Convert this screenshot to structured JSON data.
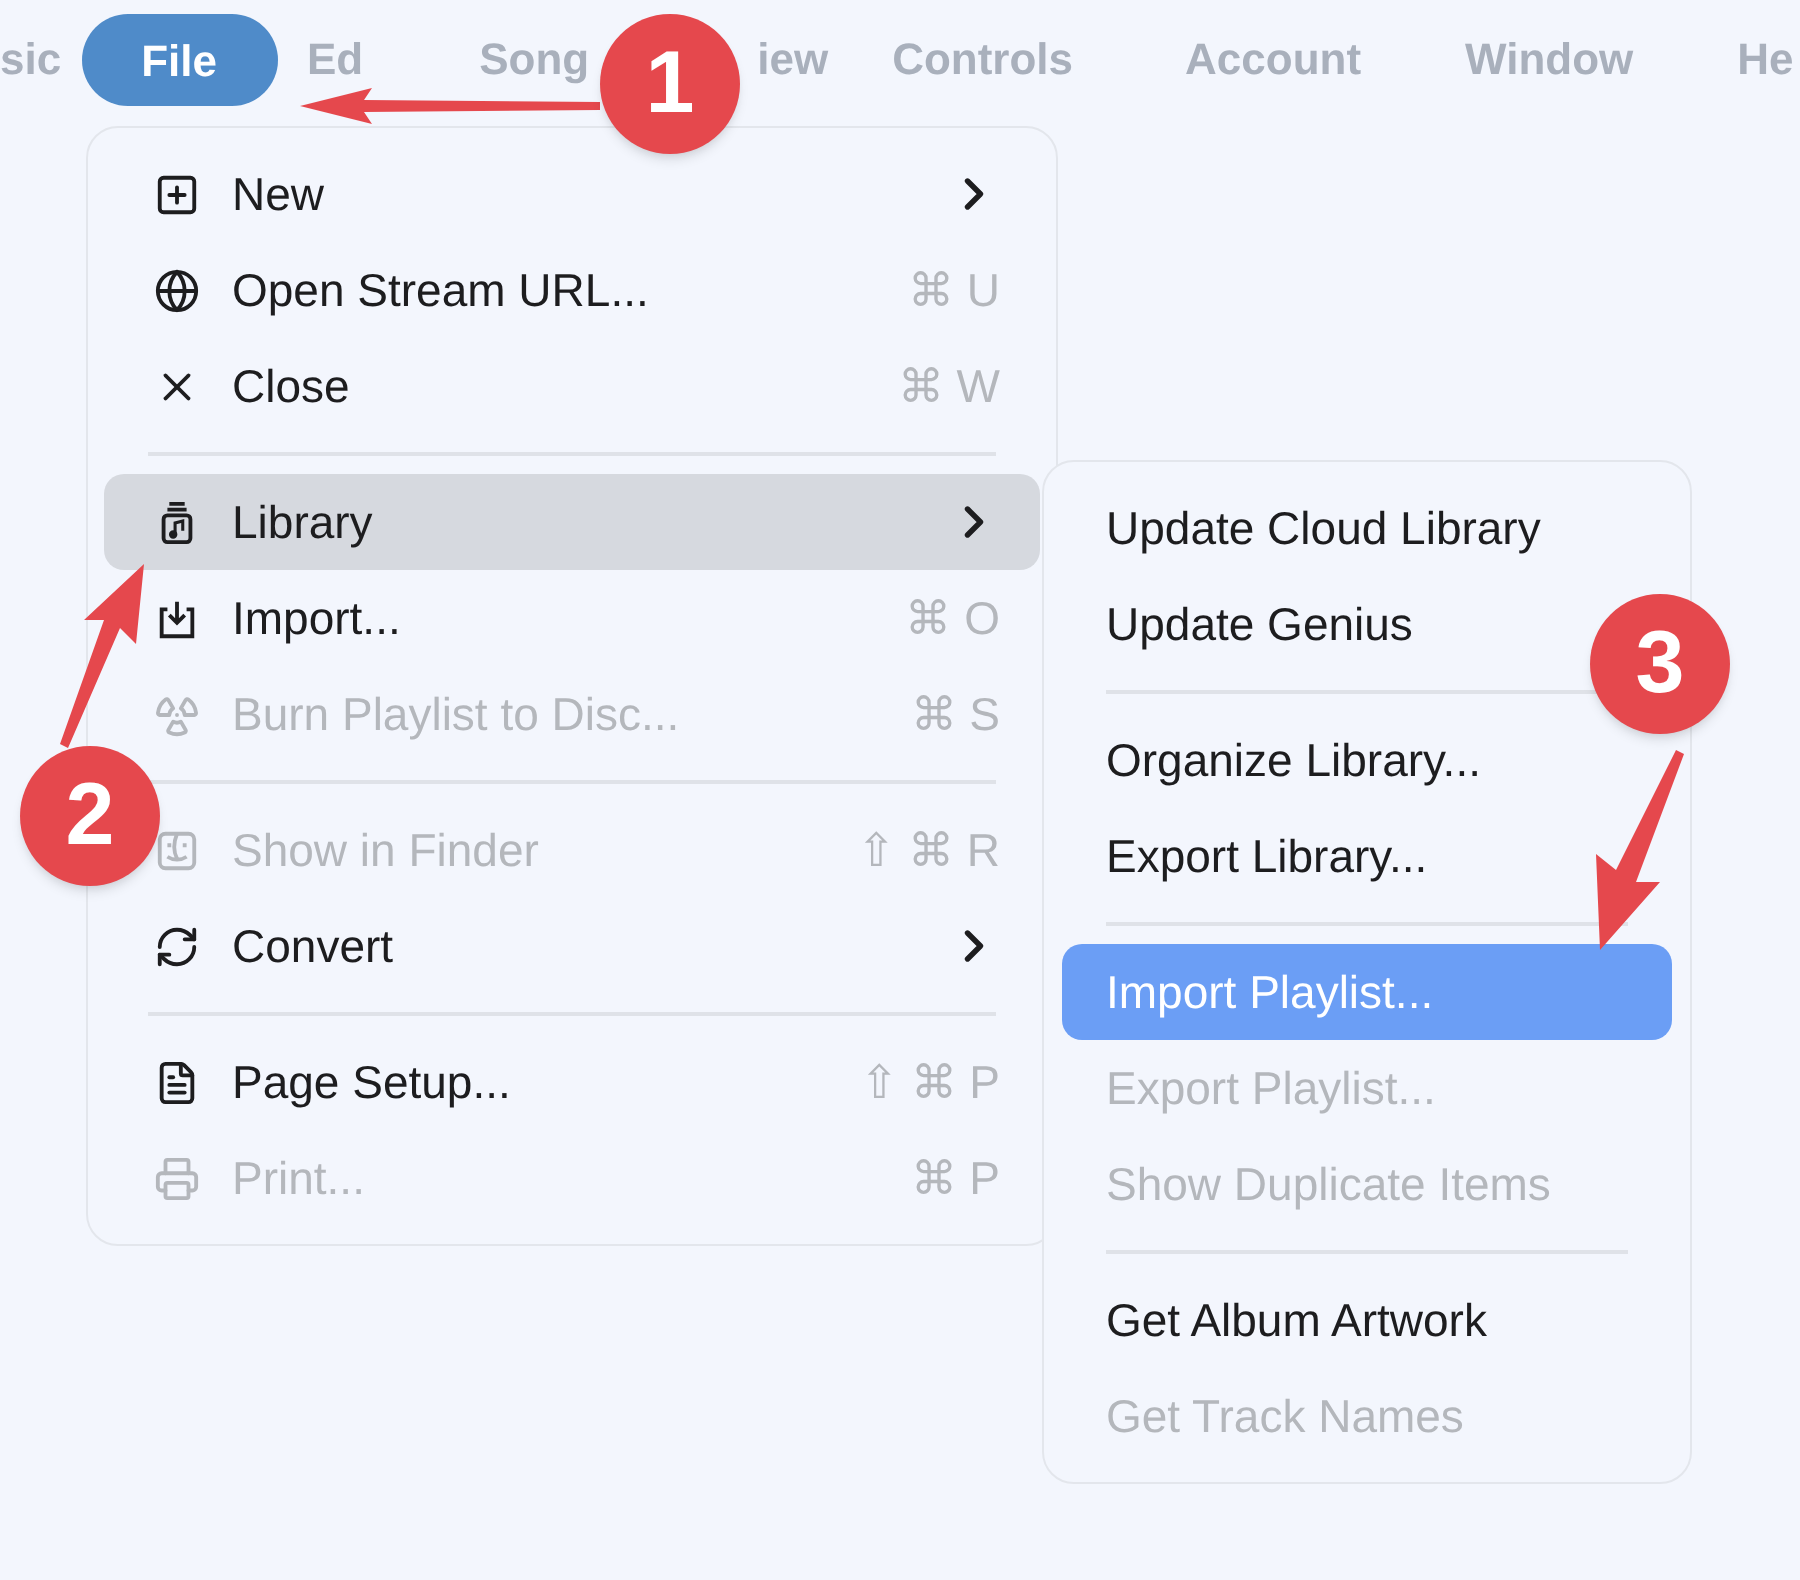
{
  "menu_bar": [
    {
      "label": "sic",
      "selected": false
    },
    {
      "label": "File",
      "selected": true
    },
    {
      "label": "Ed",
      "selected": false
    },
    {
      "label": "Song",
      "selected": false
    },
    {
      "label": "iew",
      "selected": false
    },
    {
      "label": "Controls",
      "selected": false
    },
    {
      "label": "Account",
      "selected": false
    },
    {
      "label": "Window",
      "selected": false
    },
    {
      "label": "He",
      "selected": false
    }
  ],
  "file_menu": {
    "sections": [
      [
        {
          "label": "New",
          "submenu": true,
          "disabled": false,
          "selected": false
        },
        {
          "label": "Open Stream URL...",
          "shortcut": "⌘ U",
          "submenu": false,
          "disabled": false,
          "selected": false
        },
        {
          "label": "Close",
          "shortcut": "⌘ W",
          "submenu": false,
          "disabled": false,
          "selected": false
        }
      ],
      [
        {
          "label": "Library",
          "submenu": true,
          "disabled": false,
          "selected": true
        },
        {
          "label": "Import...",
          "shortcut": "⌘ O",
          "submenu": false,
          "disabled": false,
          "selected": false
        },
        {
          "label": "Burn Playlist to Disc...",
          "shortcut": "⌘ S",
          "submenu": false,
          "disabled": true,
          "selected": false
        }
      ],
      [
        {
          "label": "Show in Finder",
          "shortcut": "⇧ ⌘ R",
          "submenu": false,
          "disabled": true,
          "selected": false
        },
        {
          "label": "Convert",
          "submenu": true,
          "disabled": false,
          "selected": false
        }
      ],
      [
        {
          "label": "Page Setup...",
          "shortcut": "⇧ ⌘ P",
          "submenu": false,
          "disabled": false,
          "selected": false
        },
        {
          "label": "Print...",
          "shortcut": "⌘ P",
          "submenu": false,
          "disabled": true,
          "selected": false
        }
      ]
    ]
  },
  "library_submenu": {
    "sections": [
      [
        {
          "label": "Update Cloud Library",
          "disabled": false,
          "selected": false
        },
        {
          "label": "Update Genius",
          "disabled": false,
          "selected": false
        }
      ],
      [
        {
          "label": "Organize Library...",
          "disabled": false,
          "selected": false
        },
        {
          "label": "Export Library...",
          "disabled": false,
          "selected": false
        }
      ],
      [
        {
          "label": "Import Playlist...",
          "disabled": false,
          "selected": true
        },
        {
          "label": "Export Playlist...",
          "disabled": true,
          "selected": false
        },
        {
          "label": "Show Duplicate Items",
          "disabled": true,
          "selected": false
        }
      ],
      [
        {
          "label": "Get Album Artwork",
          "disabled": false,
          "selected": false
        },
        {
          "label": "Get Track Names",
          "disabled": true,
          "selected": false
        }
      ]
    ]
  },
  "annotations": [
    {
      "label": "1"
    },
    {
      "label": "2"
    },
    {
      "label": "3"
    }
  ]
}
